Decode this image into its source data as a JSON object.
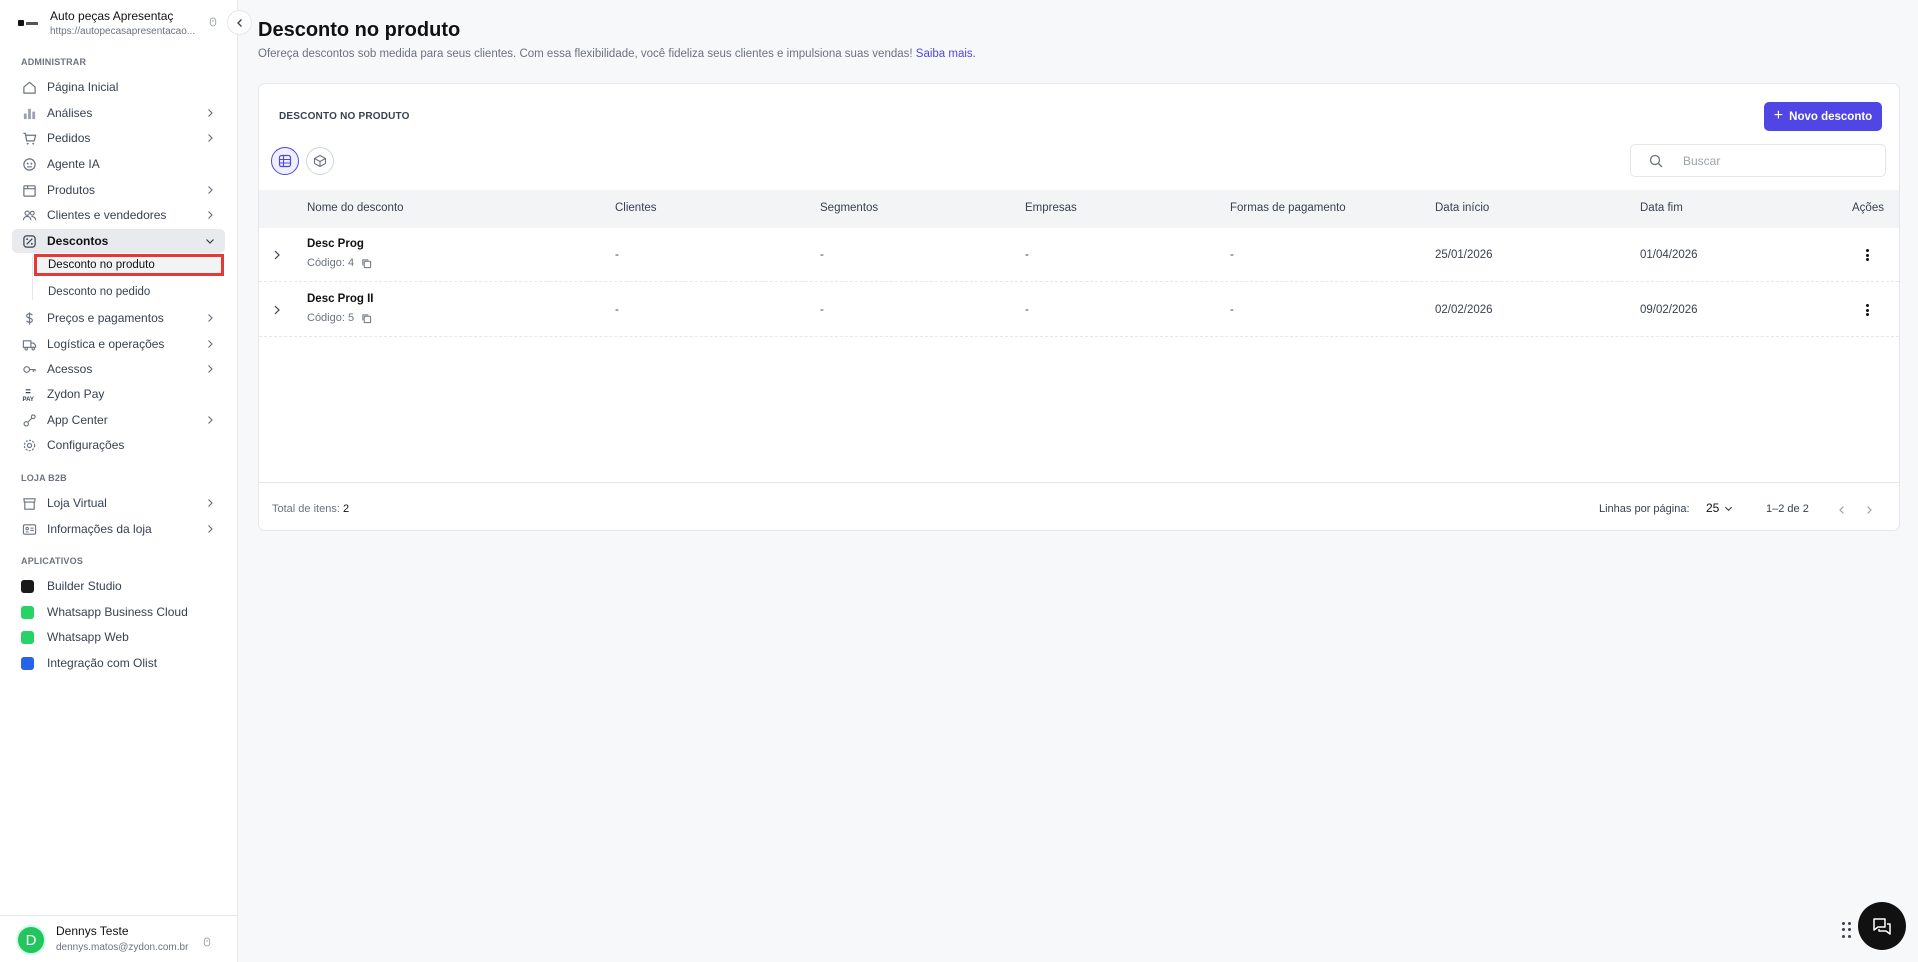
{
  "store": {
    "name": "Auto peças Apresentaç",
    "url": "https://autopecasapresentacao..."
  },
  "sidebar": {
    "section_admin": "ADMINISTRAR",
    "section_loja": "LOJA B2B",
    "section_apps": "APLICATIVOS",
    "items": [
      {
        "label": "Página Inicial",
        "icon": "home-icon"
      },
      {
        "label": "Análises",
        "icon": "chart-icon"
      },
      {
        "label": "Pedidos",
        "icon": "cart-icon"
      },
      {
        "label": "Agente IA",
        "icon": "robot-icon"
      },
      {
        "label": "Produtos",
        "icon": "box-icon"
      },
      {
        "label": "Clientes e vendedores",
        "icon": "users-icon"
      },
      {
        "label": "Descontos",
        "icon": "discount-icon"
      },
      {
        "label": "Preços e pagamentos",
        "icon": "dollar-icon"
      },
      {
        "label": "Logística e operações",
        "icon": "truck-icon"
      },
      {
        "label": "Acessos",
        "icon": "key-icon"
      },
      {
        "label": "Zydon Pay",
        "icon": "pay-icon"
      },
      {
        "label": "App Center",
        "icon": "apps-icon"
      },
      {
        "label": "Configurações",
        "icon": "gear-icon"
      }
    ],
    "sub_items": [
      {
        "label": "Desconto no produto"
      },
      {
        "label": "Desconto no pedido"
      }
    ],
    "loja_items": [
      {
        "label": "Loja Virtual",
        "icon": "store-icon"
      },
      {
        "label": "Informações da loja",
        "icon": "info-card-icon"
      }
    ],
    "apps": [
      {
        "label": "Builder Studio",
        "color": "#1a1a1a"
      },
      {
        "label": "Whatsapp Business Cloud",
        "color": "#25d366"
      },
      {
        "label": "Whatsapp Web",
        "color": "#25d366"
      },
      {
        "label": "Integração com Olist",
        "color": "#2563eb"
      }
    ]
  },
  "user": {
    "initial": "D",
    "name": "Dennys Teste",
    "email": "dennys.matos@zydon.com.br"
  },
  "main": {
    "title": "Desconto no produto",
    "description": "Ofereça descontos sob medida para seus clientes. Com essa flexibilidade, você fideliza seus clientes e impulsiona suas vendas!",
    "learn_more": "Saiba mais.",
    "card_title": "DESCONTO NO PRODUTO",
    "new_button": "Novo desconto",
    "search_placeholder": "Buscar",
    "columns": [
      "Nome do desconto",
      "Clientes",
      "Segmentos",
      "Empresas",
      "Formas de pagamento",
      "Data início",
      "Data fim",
      "Ações"
    ],
    "rows": [
      {
        "name": "Desc Prog",
        "code": "Código: 4",
        "clientes": "-",
        "segmentos": "-",
        "empresas": "-",
        "formas": "-",
        "inicio": "25/01/2026",
        "fim": "01/04/2026"
      },
      {
        "name": "Desc Prog II",
        "code": "Código: 5",
        "clientes": "-",
        "segmentos": "-",
        "empresas": "-",
        "formas": "-",
        "inicio": "02/02/2026",
        "fim": "09/02/2026"
      }
    ],
    "footer": {
      "total_label": "Total de itens:",
      "total_value": "2",
      "rows_per_page_label": "Linhas por página:",
      "rows_per_page": "25",
      "range": "1–2 de 2"
    }
  },
  "colors": {
    "accent": "#4f46e5",
    "highlight_border": "#e53935"
  }
}
